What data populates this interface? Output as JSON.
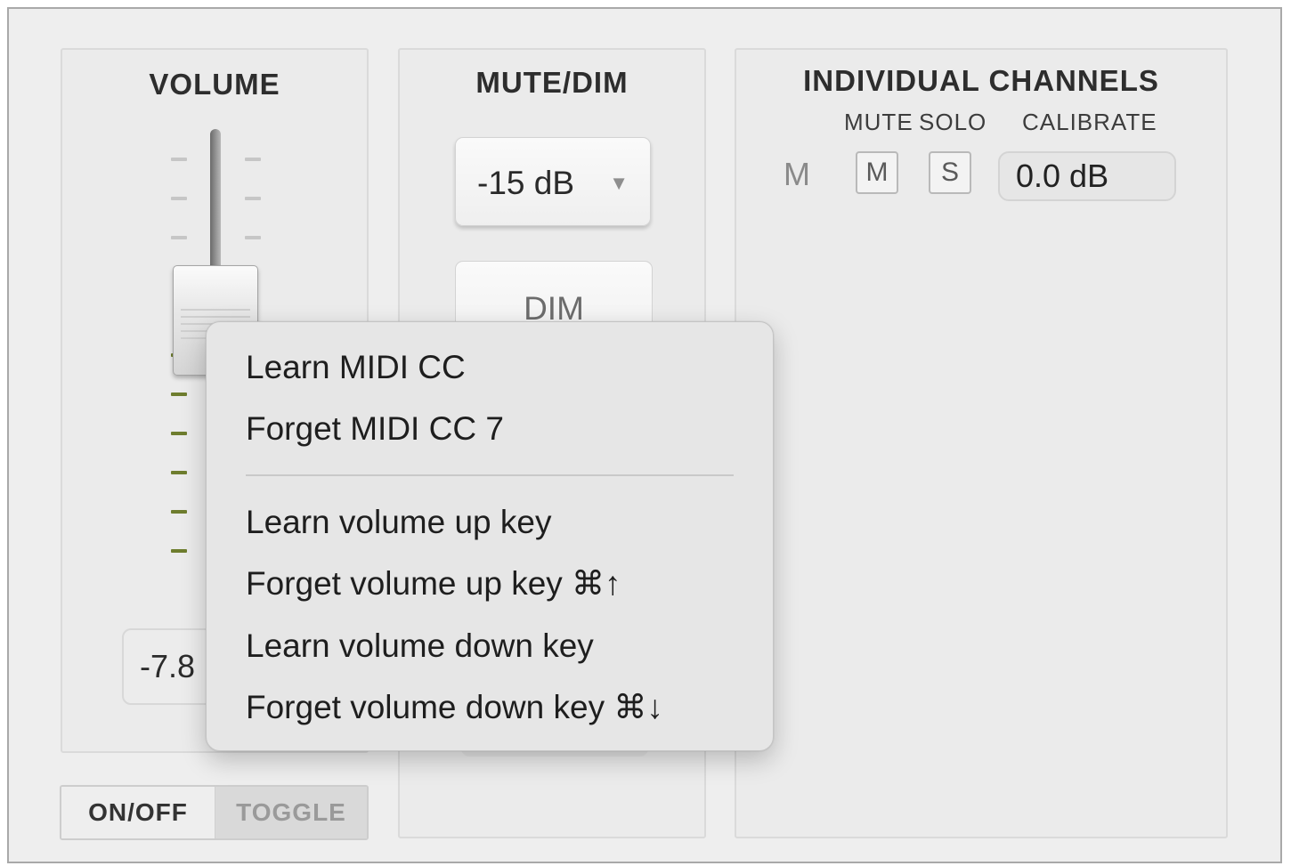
{
  "volume": {
    "title": "VOLUME",
    "value": "-7.8",
    "toggle_on_label": "ON/OFF",
    "toggle_label": "TOGGLE"
  },
  "mute_dim": {
    "title": "MUTE/DIM",
    "dim_level": "-15 dB",
    "dim_button": "DIM"
  },
  "channels": {
    "title": "INDIVIDUAL CHANNELS",
    "headers": {
      "mute": "MUTE",
      "solo": "SOLO",
      "calibrate": "CALIBRATE"
    },
    "rows": [
      {
        "label": "M",
        "mute_btn": "M",
        "solo_btn": "S",
        "calibrate": "0.0 dB"
      }
    ]
  },
  "context_menu": {
    "items": [
      "Learn MIDI CC",
      "Forget MIDI CC 7",
      "Learn volume up key",
      "Forget volume up key ⌘↑",
      "Learn volume down key",
      "Forget volume down key ⌘↓"
    ]
  },
  "colors": {
    "tick_active": "#6e7d2e",
    "tick_inactive": "#c6c6c6"
  }
}
